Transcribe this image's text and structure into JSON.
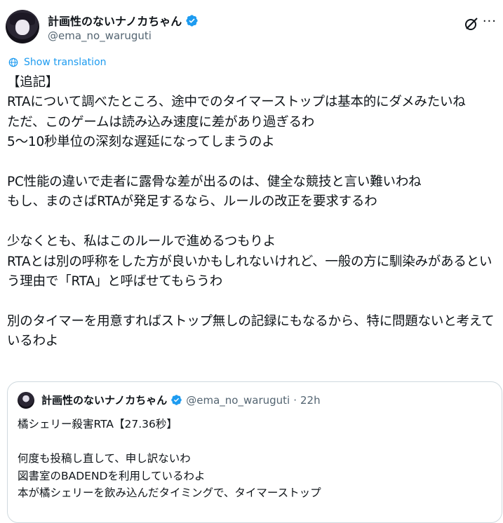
{
  "author": {
    "display_name": "計画性のないナノカちゃん",
    "handle": "@ema_no_waruguti"
  },
  "colors": {
    "link": "#1d9bf0",
    "muted": "#536471",
    "verified": "#1d9bf0"
  },
  "translate_label": "Show translation",
  "tweet_text": "【追記】\nRTAについて調べたところ、途中でのタイマーストップは基本的にダメみたいね\nただ、このゲームは読み込み速度に差があり過ぎるわ\n5〜10秒単位の深刻な遅延になってしまうのよ\n\nPC性能の違いで走者に露骨な差が出るのは、健全な競技と言い難いわね\nもし、まのさばRTAが発足するなら、ルールの改正を要求するわ\n\n少なくとも、私はこのルールで進めるつもりよ\nRTAとは別の呼称をした方が良いかもしれないけれど、一般の方に馴染みがあるという理由で「RTA」と呼ばせてもらうわ\n\n別のタイマーを用意すればストップ無しの記録にもなるから、特に問題ないと考えているわよ",
  "quote": {
    "display_name": "計画性のないナノカちゃん",
    "handle": "@ema_no_waruguti",
    "separator": "·",
    "time": "22h",
    "text": "橘シェリー殺害RTA【27.36秒】\n\n何度も投稿し直して、申し訳ないわ\n図書室のBADENDを利用しているわよ\n本が橘シェリーを飲み込んだタイミングで、タイマーストップ"
  },
  "icons": {
    "verified": "verified-badge-icon",
    "grok": "grok-icon",
    "more": "more-options-icon",
    "translate": "globe-icon"
  }
}
